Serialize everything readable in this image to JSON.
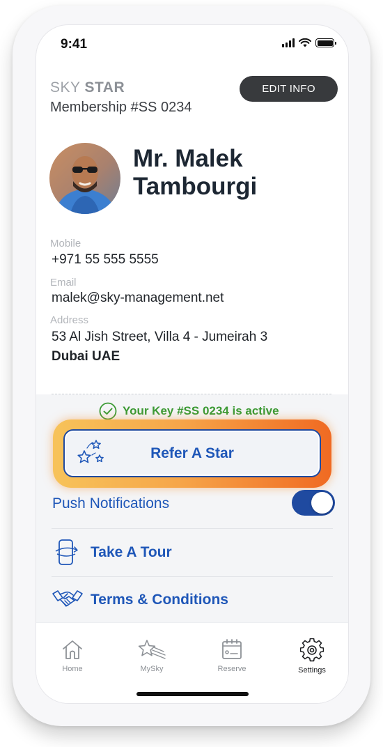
{
  "status_bar": {
    "time": "9:41"
  },
  "header": {
    "brand_light": "SKY",
    "brand_bold": "STAR",
    "membership": "Membership #SS 0234",
    "edit_label": "EDIT INFO"
  },
  "profile": {
    "name": "Mr. Malek Tambourgi",
    "fields": [
      {
        "label": "Mobile",
        "value": "+971 55 555 5555"
      },
      {
        "label": "Email",
        "value": "malek@sky-management.net"
      },
      {
        "label": "Address",
        "value": "53 Al Jish Street, Villa 4 - Jumeirah 3",
        "value2": "Dubai UAE"
      }
    ]
  },
  "key_status": {
    "text": "Your Key #SS 0234 is active",
    "color": "#3b9a34"
  },
  "refer": {
    "label": "Refer A Star"
  },
  "settings": {
    "push_label": "Push Notifications",
    "push_enabled": true,
    "items": [
      {
        "label": "Take A Tour",
        "icon": "phone-rotate-icon"
      },
      {
        "label": "Terms & Conditions",
        "icon": "handshake-icon"
      }
    ]
  },
  "tabbar": {
    "tabs": [
      {
        "label": "Home",
        "icon": "home-icon"
      },
      {
        "label": "MySky",
        "icon": "star-icon"
      },
      {
        "label": "Reserve",
        "icon": "calendar-icon"
      },
      {
        "label": "Settings",
        "icon": "gear-icon",
        "active": true
      }
    ]
  },
  "colors": {
    "accent": "#1f57b8",
    "dark_button": "#383a3d",
    "glow_start": "#f7c35a",
    "glow_end": "#f06a22"
  }
}
